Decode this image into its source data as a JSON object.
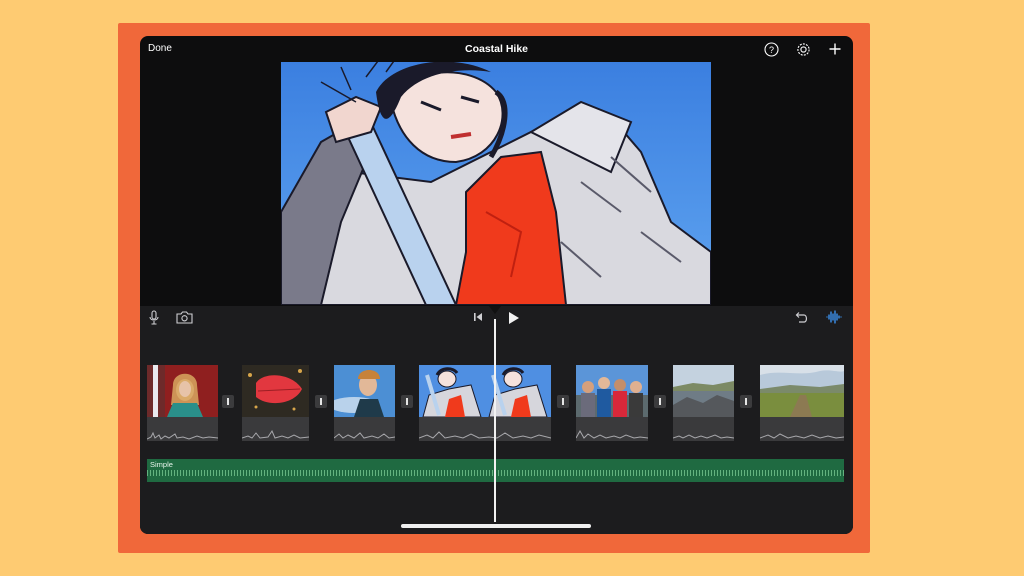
{
  "app": {
    "done_label": "Done",
    "project_title": "Coastal Hike"
  },
  "topbar_icons": [
    "help-icon",
    "settings-icon",
    "add-icon"
  ],
  "timeline_toolbar": {
    "left_icons": [
      "microphone-icon",
      "camera-icon"
    ],
    "center_icons": [
      "skip-to-start-icon",
      "play-icon"
    ],
    "right_icons": [
      "undo-icon",
      "audio-waveform-icon"
    ]
  },
  "clips": [
    {
      "subject": "portrait-red-wall"
    },
    {
      "subject": "red-leaf"
    },
    {
      "subject": "woman-beanie-sky"
    },
    {
      "subject": "cartoon-selfie"
    },
    {
      "subject": "group-selfie"
    },
    {
      "subject": "rocky-coast"
    },
    {
      "subject": "green-meadow"
    }
  ],
  "music_track": {
    "label": "Simple"
  },
  "colors": {
    "frame": "#F0683A",
    "background": "#FECB72",
    "music_track": "#1f6a41",
    "accent_blue": "#3f9bff"
  }
}
